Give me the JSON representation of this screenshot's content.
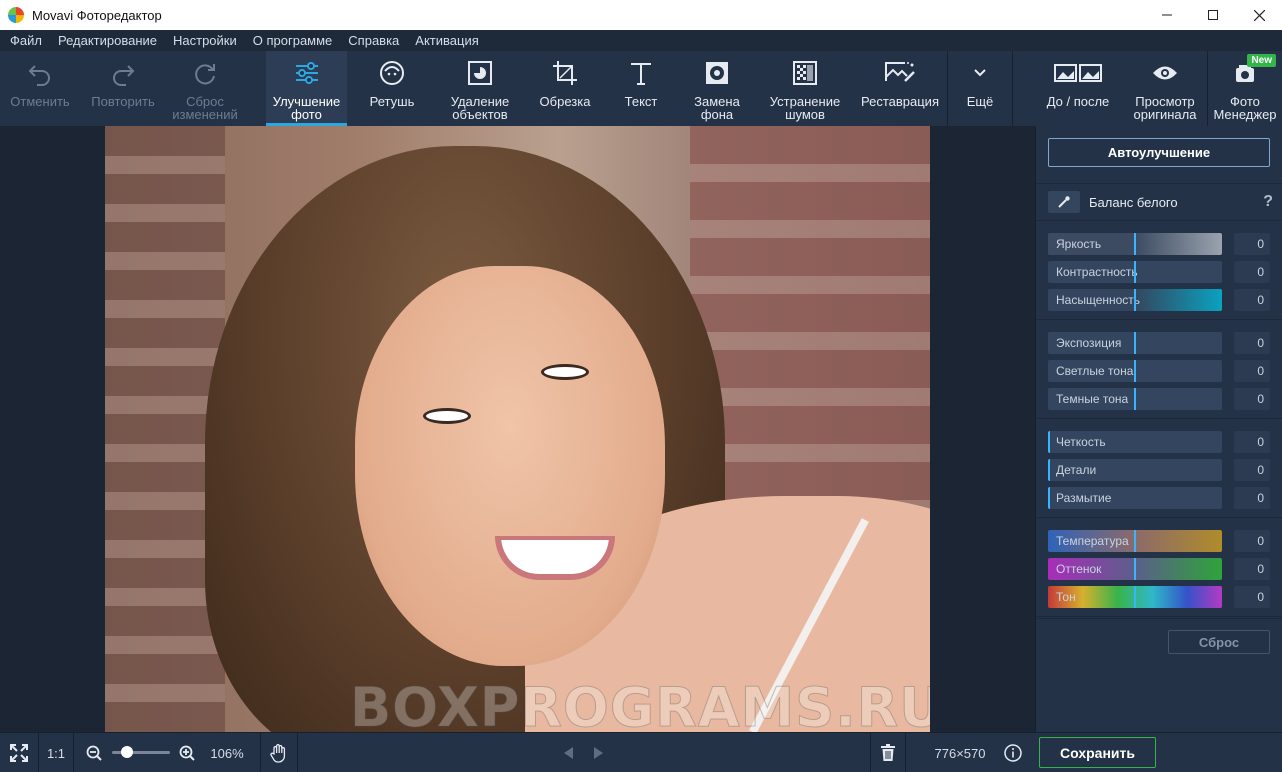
{
  "window": {
    "title": "Movavi Фоторедактор"
  },
  "menu": [
    "Файл",
    "Редактирование",
    "Настройки",
    "О программе",
    "Справка",
    "Активация"
  ],
  "toolbar": {
    "undo": "Отменить",
    "redo": "Повторить",
    "reset_changes": "Сброс\nизменений",
    "enhance": "Улучшение\nфото",
    "retouch": "Ретушь",
    "remove_objects": "Удаление\nобъектов",
    "crop": "Обрезка",
    "text": "Текст",
    "replace_bg": "Замена\nфона",
    "denoise": "Устранение\nшумов",
    "restore": "Реставрация",
    "more": "Ещё",
    "before_after": "До / после",
    "view_original": "Просмотр\nоригинала",
    "photo_manager": "Фото\nМенеджер",
    "new_badge": "New"
  },
  "photo": {
    "watermark": "BOXPROGRAMS.RU"
  },
  "panel": {
    "auto_enhance": "Автоулучшение",
    "white_balance": "Баланс белого",
    "help": "?",
    "groups": [
      [
        {
          "name": "Яркость",
          "value": "0",
          "level": 0.5
        },
        {
          "name": "Контрастность",
          "value": "0",
          "level": 0.5
        },
        {
          "name": "Насыщенность",
          "value": "0",
          "level": 0.5
        }
      ],
      [
        {
          "name": "Экспозиция",
          "value": "0",
          "level": 0.5
        },
        {
          "name": "Светлые тона",
          "value": "0",
          "level": 0.5
        },
        {
          "name": "Темные тона",
          "value": "0",
          "level": 0.5
        }
      ],
      [
        {
          "name": "Четкость",
          "value": "0",
          "level": 0
        },
        {
          "name": "Детали",
          "value": "0",
          "level": 0
        },
        {
          "name": "Размытие",
          "value": "0",
          "level": 0
        }
      ],
      [
        {
          "name": "Температура",
          "value": "0",
          "level": 0.5
        },
        {
          "name": "Оттенок",
          "value": "0",
          "level": 0.5
        },
        {
          "name": "Тон",
          "value": "0",
          "level": 0.5
        }
      ]
    ],
    "reset": "Сброс"
  },
  "bottom": {
    "one_to_one": "1:1",
    "zoom": "106%",
    "zoom_level": 0.25,
    "dimensions": "776×570",
    "save": "Сохранить"
  },
  "colors": {
    "accent": "#2ca8e0",
    "save_border": "#33b54a",
    "panel_bg": "#243247"
  }
}
